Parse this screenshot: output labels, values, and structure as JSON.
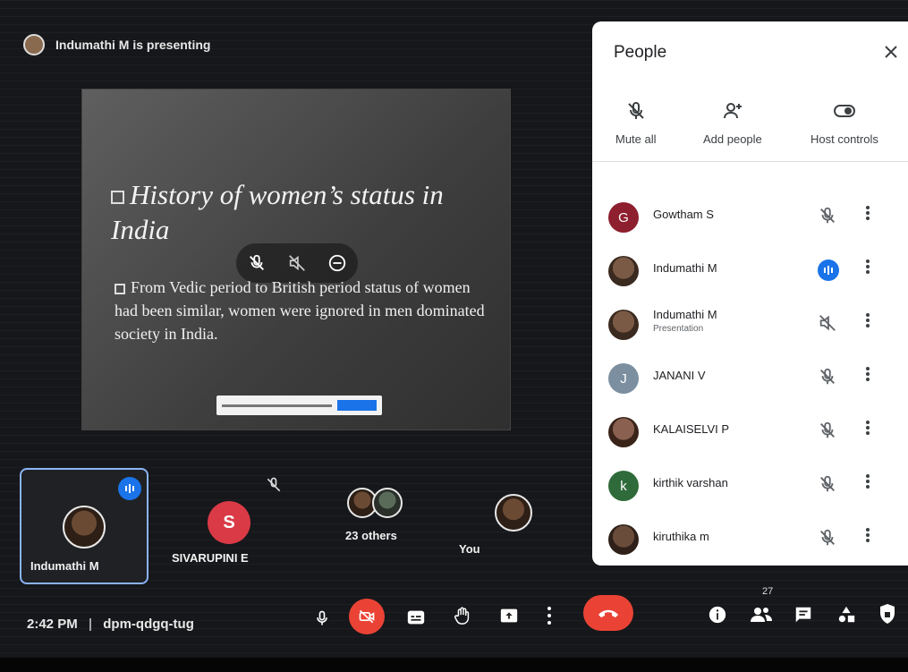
{
  "presenter_banner": "Indumathi M is presenting",
  "slide": {
    "title": "History of women’s status in India",
    "body": "From Vedic period to British period status of women had been similar, women were ignored in men dominated society in India."
  },
  "tiles": {
    "main_name": "Indumathi M",
    "participant2_initial": "S",
    "participant2_name": "SIVARUPINI E",
    "others_label": "23 others",
    "you_label": "You"
  },
  "bottom": {
    "time": "2:42 PM",
    "separator": "|",
    "meeting_code": "dpm-qdgq-tug",
    "people_count": "27"
  },
  "people_panel": {
    "title": "People",
    "actions": [
      {
        "label": "Mute all",
        "icon": "mic-off-icon"
      },
      {
        "label": "Add people",
        "icon": "add-person-icon"
      },
      {
        "label": "Host controls",
        "icon": "toggle-icon"
      }
    ],
    "participants": [
      {
        "initial": "G",
        "name": "Gowtham S",
        "subtitle": "",
        "avatar_color": "#8e1f2e",
        "status": "muted"
      },
      {
        "initial": "",
        "name": "Indumathi M",
        "subtitle": "",
        "avatar_color": "#7a5a45",
        "status": "speaking"
      },
      {
        "initial": "",
        "name": "Indumathi M",
        "subtitle": "Presentation",
        "avatar_color": "#7a5a45",
        "status": "audio-off"
      },
      {
        "initial": "J",
        "name": "JANANI V",
        "subtitle": "",
        "avatar_color": "#7c8fa0",
        "status": "muted"
      },
      {
        "initial": "",
        "name": "KALAISELVI P",
        "subtitle": "",
        "avatar_color": "#5a3a2c",
        "status": "muted"
      },
      {
        "initial": "k",
        "name": "kirthik varshan",
        "subtitle": "",
        "avatar_color": "#2f6b3a",
        "status": "muted"
      },
      {
        "initial": "",
        "name": "kiruthika m",
        "subtitle": "",
        "avatar_color": "#6a4c3b",
        "status": "muted"
      }
    ]
  },
  "colors": {
    "accent_blue": "#1a73e8",
    "end_call_red": "#ea4335",
    "tile_border": "#8ab4f8",
    "red_avatar": "#d93a46"
  }
}
